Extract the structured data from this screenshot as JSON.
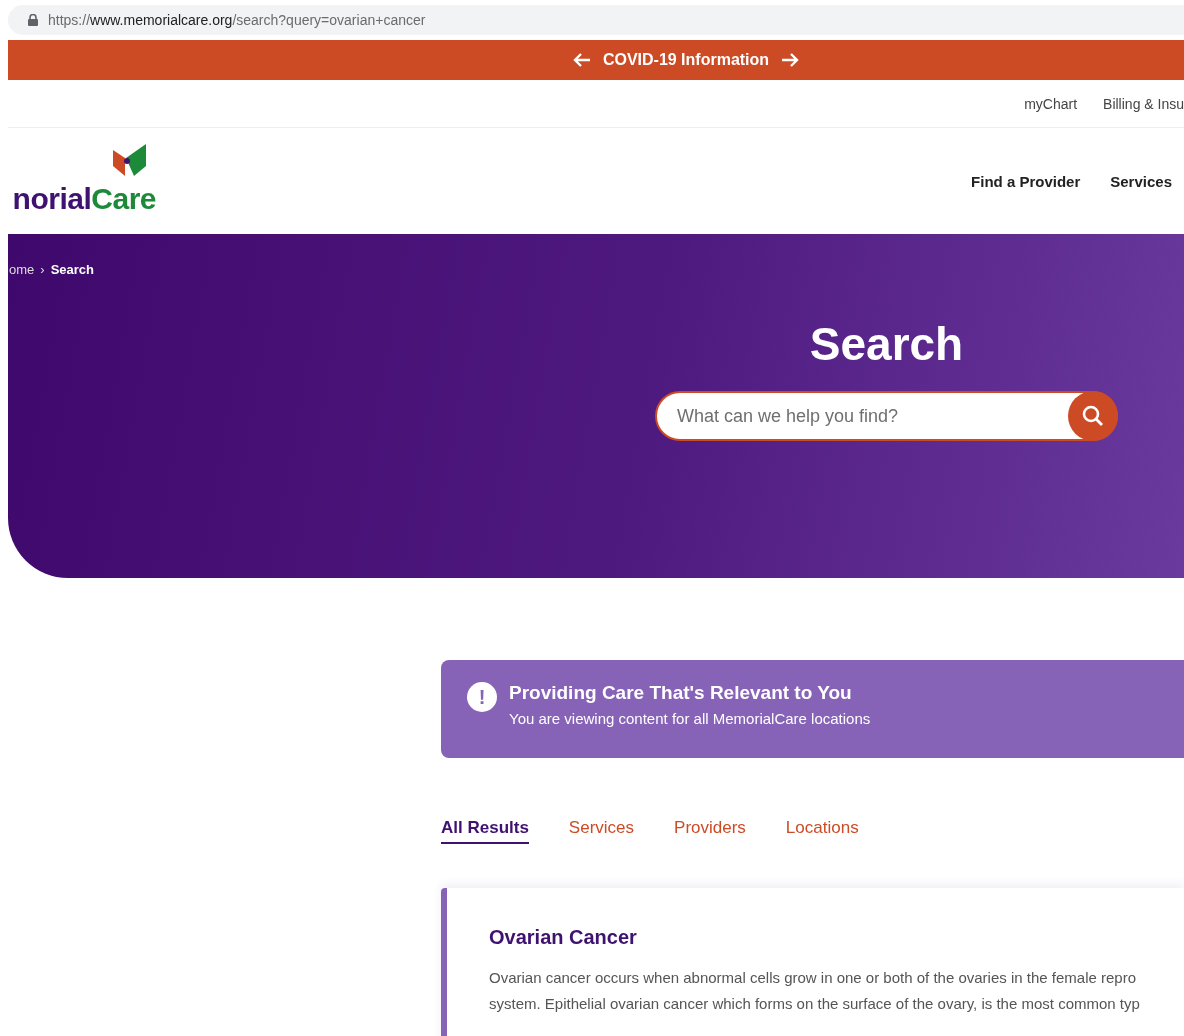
{
  "browser": {
    "url": {
      "scheme": "https://",
      "host": "www.memorialcare.org",
      "path": "/search?query=ovarian+cancer"
    }
  },
  "alert_bar": {
    "label": "COVID-19 Information"
  },
  "utility_nav": [
    "myChart",
    "Billing & Insu"
  ],
  "logo": {
    "text_start": "norial",
    "text_end": "Care"
  },
  "main_nav": [
    "Find a Provider",
    "Services"
  ],
  "hero": {
    "breadcrumb_separator": "›",
    "breadcrumb": [
      {
        "label": "ome",
        "current": false
      },
      {
        "label": "Search",
        "current": true
      }
    ],
    "title": "Search",
    "search": {
      "placeholder": "What can we help you find?"
    }
  },
  "notice": {
    "icon": "!",
    "title": "Providing Care That's Relevant to You",
    "text": "You are viewing content for all MemorialCare locations"
  },
  "tabs": [
    {
      "label": "All Results",
      "selected": true
    },
    {
      "label": "Services",
      "selected": false
    },
    {
      "label": "Providers",
      "selected": false
    },
    {
      "label": "Locations",
      "selected": false
    }
  ],
  "results": [
    {
      "title": "Ovarian Cancer",
      "lines": [
        "Ovarian cancer occurs when abnormal cells grow in one or both of the ovaries in the female repro",
        "system. Epithelial ovarian cancer which forms on the surface of the ovary, is the most common typ"
      ]
    }
  ]
}
